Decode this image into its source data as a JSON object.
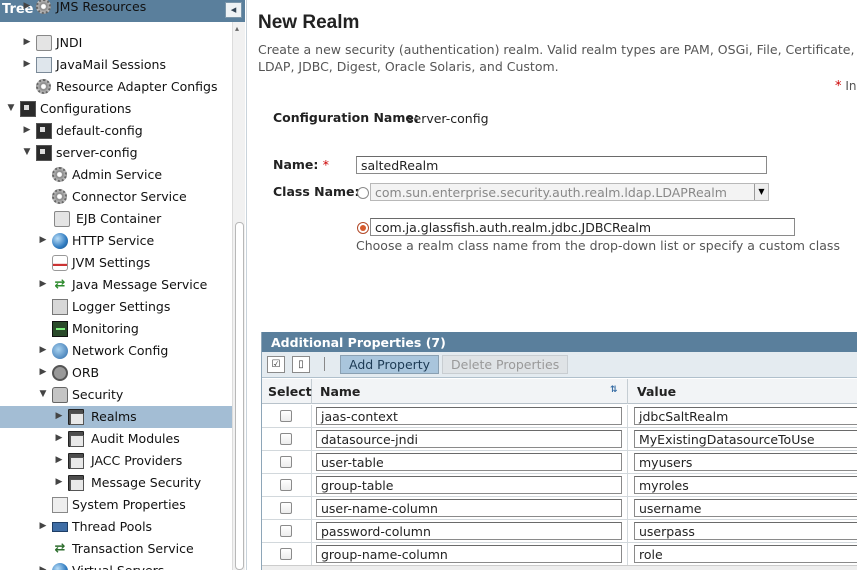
{
  "tree": {
    "title": "Tree",
    "collapse_glyph": "◂",
    "items": [
      {
        "label": "JMS Resources",
        "icon": "gear-icon"
      },
      {
        "label": "JNDI",
        "icon": "jndi-icon"
      },
      {
        "label": "JavaMail Sessions",
        "icon": "mail-icon"
      },
      {
        "label": "Resource Adapter Configs",
        "icon": "gear-icon"
      },
      {
        "label": "Configurations",
        "icon": "server-icon"
      },
      {
        "label": "default-config",
        "icon": "server-icon"
      },
      {
        "label": "server-config",
        "icon": "server-icon"
      },
      {
        "label": "Admin Service",
        "icon": "gear-icon"
      },
      {
        "label": "Connector Service",
        "icon": "gear-icon"
      },
      {
        "label": "EJB Container",
        "icon": "jar-icon"
      },
      {
        "label": "HTTP Service",
        "icon": "globe-icon"
      },
      {
        "label": "JVM Settings",
        "icon": "java-icon"
      },
      {
        "label": "Java Message Service",
        "icon": "arrows-icon"
      },
      {
        "label": "Logger Settings",
        "icon": "log-icon"
      },
      {
        "label": "Monitoring",
        "icon": "monitor-icon"
      },
      {
        "label": "Network Config",
        "icon": "network-icon"
      },
      {
        "label": "ORB",
        "icon": "orb-icon"
      },
      {
        "label": "Security",
        "icon": "lock-icon"
      },
      {
        "label": "Realms",
        "icon": "folder-icon"
      },
      {
        "label": "Audit Modules",
        "icon": "folder-icon"
      },
      {
        "label": "JACC Providers",
        "icon": "folder-icon"
      },
      {
        "label": "Message Security",
        "icon": "folder-icon"
      },
      {
        "label": "System Properties",
        "icon": "properties-icon"
      },
      {
        "label": "Thread Pools",
        "icon": "thread-pool-icon"
      },
      {
        "label": "Transaction Service",
        "icon": "transaction-icon"
      },
      {
        "label": "Virtual Servers",
        "icon": "globe-icon"
      }
    ]
  },
  "page": {
    "title": "New Realm",
    "help": "Create a new security (authentication) realm. Valid realm types are PAM, OSGi, File, Certificate, LDAP, JDBC, Digest, Oracle Solaris, and Custom.",
    "required_star": "*",
    "required_text": "In"
  },
  "form": {
    "config_label": "Configuration Name:",
    "config_value": "server-config",
    "name_label": "Name:",
    "name_star": "*",
    "name_value": "saltedRealm",
    "class_label": "Class Name:",
    "class_dropdown_value": "com.sun.enterprise.security.auth.realm.ldap.LDAPRealm",
    "class_custom_value": "com.ja.glassfish.auth.realm.jdbc.JDBCRealm",
    "class_help": "Choose a realm class name from the drop-down list or specify a custom class"
  },
  "properties": {
    "title": "Additional Properties (7)",
    "add_label": "Add Property",
    "delete_label": "Delete Properties",
    "col_select": "Select",
    "col_name": "Name",
    "col_value": "Value",
    "rows": [
      {
        "name": "jaas-context",
        "value": "jdbcSaltRealm"
      },
      {
        "name": "datasource-jndi",
        "value": "MyExistingDatasourceToUse"
      },
      {
        "name": "user-table",
        "value": "myusers"
      },
      {
        "name": "group-table",
        "value": "myroles"
      },
      {
        "name": "user-name-column",
        "value": "username"
      },
      {
        "name": "password-column",
        "value": "userpass"
      },
      {
        "name": "group-name-column",
        "value": "role"
      }
    ]
  },
  "colors": {
    "header_bar": "#5a7f9c",
    "selection": "#a3bdd4",
    "required": "#cc0000"
  }
}
